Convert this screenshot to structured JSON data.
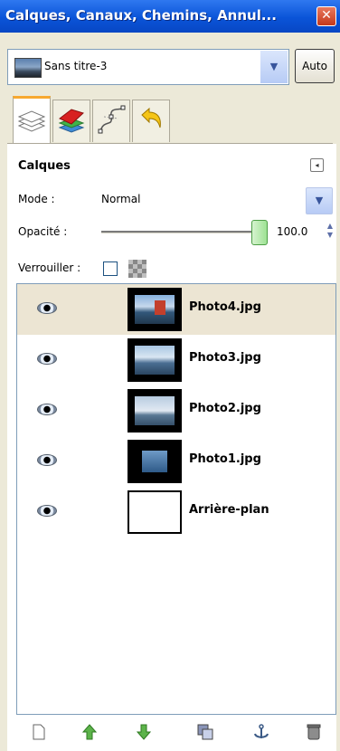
{
  "window": {
    "title": "Calques, Canaux, Chemins, Annul...",
    "close_glyph": "✕"
  },
  "image_selector": {
    "name": "Sans titre-3",
    "auto_label": "Auto"
  },
  "tabs": [
    {
      "name": "layers",
      "icon": "layers-tab-icon"
    },
    {
      "name": "channels",
      "icon": "channels-tab-icon"
    },
    {
      "name": "paths",
      "icon": "paths-tab-icon"
    },
    {
      "name": "undo",
      "icon": "undo-history-tab-icon"
    }
  ],
  "layers_panel": {
    "heading": "Calques",
    "mode_label": "Mode :",
    "mode_value": "Normal",
    "opacity_label": "Opacité :",
    "opacity_value": "100.0",
    "lock_label": "Verrouiller :",
    "layers": [
      {
        "name": "Photo4.jpg",
        "visible": true,
        "selected": true
      },
      {
        "name": "Photo3.jpg",
        "visible": true,
        "selected": false
      },
      {
        "name": "Photo2.jpg",
        "visible": true,
        "selected": false
      },
      {
        "name": "Photo1.jpg",
        "visible": true,
        "selected": false
      },
      {
        "name": "Arrière-plan",
        "visible": true,
        "selected": false
      }
    ]
  },
  "bottom_buttons": [
    "new-layer-icon",
    "raise-layer-icon",
    "lower-layer-icon",
    "duplicate-layer-icon",
    "anchor-layer-icon",
    "delete-layer-icon"
  ],
  "colors": {
    "titlebar": "#0a54d8",
    "selected_row": "#ece5d3",
    "window_bg": "#ece9d8"
  }
}
